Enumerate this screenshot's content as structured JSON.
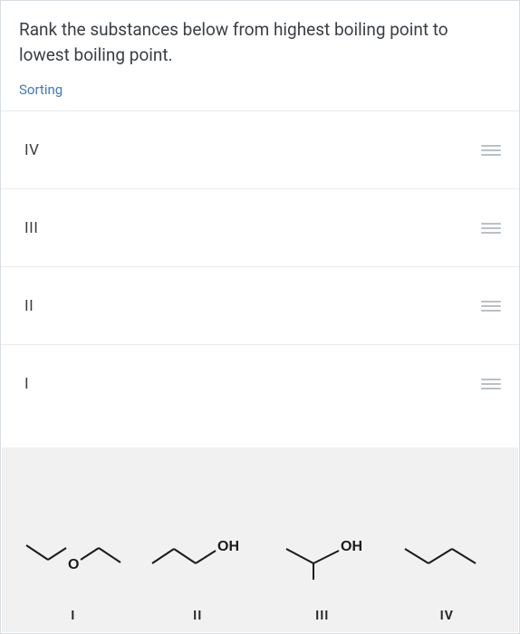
{
  "question": {
    "prompt": "Rank the substances below from highest boiling point to lowest boiling point.",
    "type_label": "Sorting"
  },
  "sort_items": [
    {
      "label": "IV"
    },
    {
      "label": "III"
    },
    {
      "label": "II"
    },
    {
      "label": "I"
    }
  ],
  "structures": [
    {
      "roman": "I",
      "oxygen_label": "O"
    },
    {
      "roman": "II",
      "oh_label": "OH"
    },
    {
      "roman": "III",
      "oh_label": "OH"
    },
    {
      "roman": "IV"
    }
  ]
}
